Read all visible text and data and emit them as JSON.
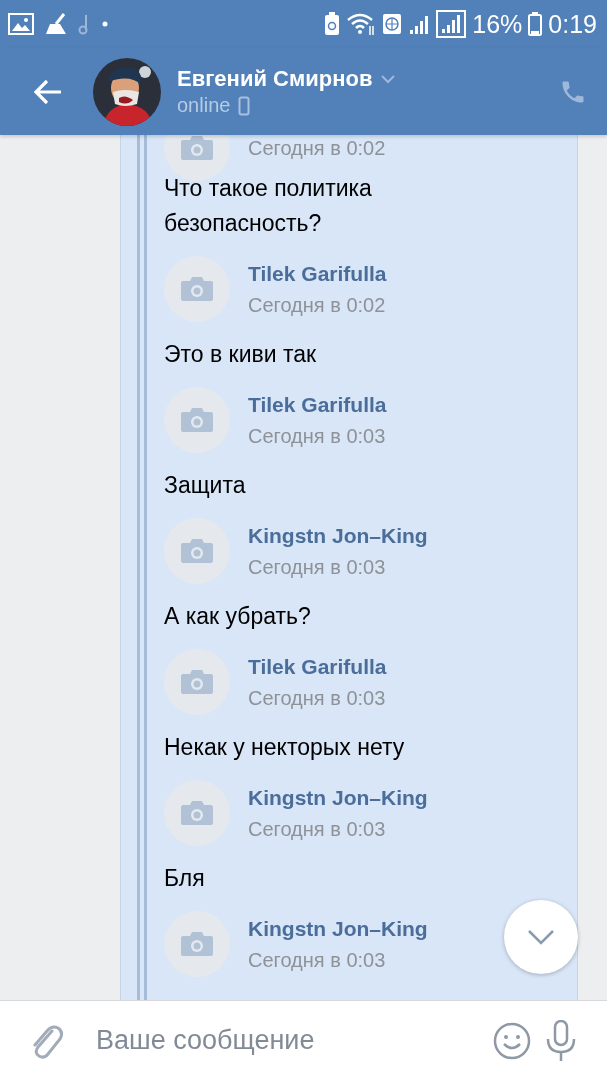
{
  "status_bar": {
    "battery": "16%",
    "time": "0:19"
  },
  "header": {
    "name": "Евгений Смирнов",
    "status": "online"
  },
  "messages": [
    {
      "kind": "author",
      "date": "Сегодня в 0:02"
    },
    {
      "kind": "text",
      "text": "Что такое политика\nбезопасность?"
    },
    {
      "kind": "author",
      "name": "Tilek Garifulla",
      "date": "Сегодня в 0:02"
    },
    {
      "kind": "text",
      "text": "Это в киви так"
    },
    {
      "kind": "author",
      "name": "Tilek Garifulla",
      "date": "Сегодня в 0:03"
    },
    {
      "kind": "text",
      "text": "Защита"
    },
    {
      "kind": "author",
      "name": "Kingstn Jon–King",
      "date": "Сегодня в 0:03"
    },
    {
      "kind": "text",
      "text": "А как убрать?"
    },
    {
      "kind": "author",
      "name": "Tilek Garifulla",
      "date": "Сегодня в 0:03"
    },
    {
      "kind": "text",
      "text": "Некак у некторых нету"
    },
    {
      "kind": "author",
      "name": "Kingstn Jon–King",
      "date": "Сегодня в 0:03"
    },
    {
      "kind": "text",
      "text": "Бля"
    },
    {
      "kind": "author",
      "name": "Kingstn Jon–King",
      "date": "Сегодня в 0:03"
    }
  ],
  "composer": {
    "placeholder": "Ваше сообщение"
  }
}
